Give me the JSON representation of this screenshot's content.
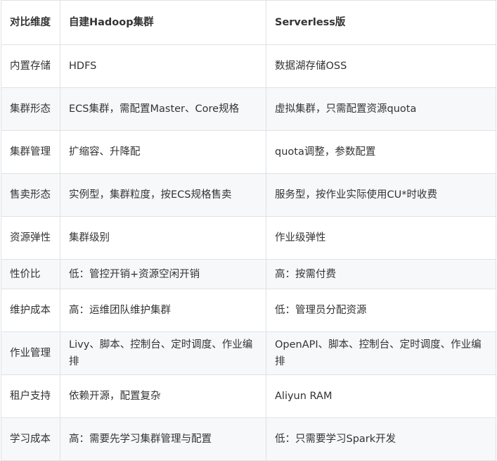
{
  "header": {
    "col1": "对比维度",
    "col2": "自建Hadoop集群",
    "col3": "Serverless版"
  },
  "rows": [
    {
      "dimension": "内置存储",
      "hadoop": "HDFS",
      "serverless": "数据湖存储OSS"
    },
    {
      "dimension": "集群形态",
      "hadoop": "ECS集群，需配置Master、Core规格",
      "serverless": "虚拟集群，只需配置资源quota"
    },
    {
      "dimension": "集群管理",
      "hadoop": "扩缩容、升降配",
      "serverless": "quota调整，参数配置"
    },
    {
      "dimension": "售卖形态",
      "hadoop": "实例型，集群粒度，按ECS规格售卖",
      "serverless": "服务型，按作业实际使用CU*时收费"
    },
    {
      "dimension": "资源弹性",
      "hadoop": "集群级别",
      "serverless": "作业级弹性"
    },
    {
      "dimension": "性价比",
      "hadoop": "低：管控开销+资源空闲开销",
      "serverless": "高：按需付费"
    },
    {
      "dimension": "维护成本",
      "hadoop": "高：运维团队维护集群",
      "serverless": "低：管理员分配资源"
    },
    {
      "dimension": "作业管理",
      "hadoop": "Livy、脚本、控制台、定时调度、作业编排",
      "serverless": "OpenAPI、脚本、控制台、定时调度、作业编排"
    },
    {
      "dimension": "租户支持",
      "hadoop": "依赖开源，配置复杂",
      "serverless": "Aliyun RAM"
    },
    {
      "dimension": "学习成本",
      "hadoop": "高：需要先学习集群管理与配置",
      "serverless": "低：只需要学习Spark开发"
    }
  ]
}
